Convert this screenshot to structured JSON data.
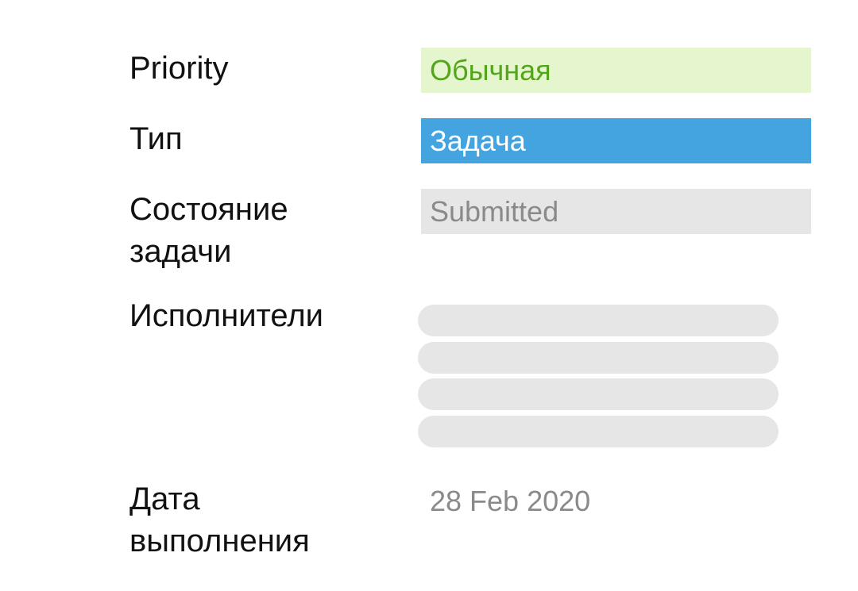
{
  "priority": {
    "label": "Priority",
    "value": "Обычная"
  },
  "type": {
    "label": "Тип",
    "value": "Задача"
  },
  "state": {
    "label_line1": "Состояние",
    "label_line2": "задачи",
    "value": "Submitted"
  },
  "assignees": {
    "label": "Исполнители",
    "placeholder_count": 4
  },
  "due_date": {
    "label_line1": "Дата",
    "label_line2": "выполнения",
    "value": "28 Feb 2020"
  },
  "colors": {
    "priority_bg": "#e5f6cf",
    "priority_text": "#53a51a",
    "type_bg": "#43a4e0",
    "type_text": "#ffffff",
    "state_bg": "#e6e6e6",
    "muted_text": "#8a8a8a"
  }
}
